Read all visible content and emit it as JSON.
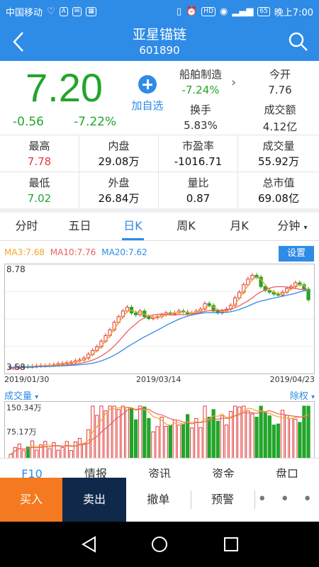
{
  "status_bar": {
    "carrier": "中国移动",
    "battery": "65",
    "time": "晚上7:00"
  },
  "header": {
    "title": "亚星锚链",
    "code": "601890"
  },
  "quote": {
    "price": "7.20",
    "change": "-0.56",
    "change_pct": "-7.22%",
    "add_watchlist": "加自选",
    "sector_name": "船舶制造",
    "sector_pct": "-7.24%",
    "open_label": "今开",
    "open_value": "7.76",
    "turnover_label": "换手",
    "turnover_value": "5.83%",
    "amount_label": "成交额",
    "amount_value": "4.12亿"
  },
  "grid": [
    {
      "label": "最高",
      "value": "7.78",
      "color": "#e03a3a"
    },
    {
      "label": "内盘",
      "value": "29.08万",
      "color": "#111111"
    },
    {
      "label": "市盈率",
      "value": "-1016.71",
      "color": "#111111"
    },
    {
      "label": "成交量",
      "value": "55.92万",
      "color": "#111111"
    },
    {
      "label": "最低",
      "value": "7.02",
      "color": "#22a52b"
    },
    {
      "label": "外盘",
      "value": "26.84万",
      "color": "#111111"
    },
    {
      "label": "量比",
      "value": "0.87",
      "color": "#111111"
    },
    {
      "label": "总市值",
      "value": "69.08亿",
      "color": "#111111"
    }
  ],
  "tabs": [
    "分时",
    "五日",
    "日K",
    "周K",
    "月K",
    "分钟"
  ],
  "active_tab": "日K",
  "chart": {
    "ma3": "MA3:7.68",
    "ma10": "MA10:7.76",
    "ma20": "MA20:7.62",
    "settings": "设置",
    "y_max": "8.78",
    "y_min": "3.58",
    "dates": [
      "2019/01/30",
      "2019/03/14",
      "2019/04/23"
    ],
    "volume_label": "成交量",
    "volume_max": "150.34万",
    "volume_mid": "75.17万",
    "adjust": "除权"
  },
  "chart_data": {
    "type": "candlestick",
    "ylim": [
      3.58,
      8.78
    ],
    "x_ticks": [
      "2019/01/30",
      "2019/03/14",
      "2019/04/23"
    ],
    "candles_approx_close": [
      3.6,
      3.62,
      3.62,
      3.65,
      3.64,
      3.66,
      3.68,
      3.7,
      3.7,
      3.72,
      3.75,
      3.8,
      3.82,
      3.85,
      3.88,
      3.95,
      4.0,
      4.1,
      4.3,
      4.5,
      4.7,
      5.0,
      5.3,
      5.6,
      6.0,
      6.3,
      6.6,
      6.8,
      6.5,
      6.4,
      6.6,
      6.3,
      6.2,
      6.25,
      6.3,
      6.4,
      6.5,
      6.45,
      6.5,
      6.6,
      6.55,
      6.45,
      6.5,
      6.6,
      6.7,
      7.0,
      6.9,
      6.6,
      6.5,
      6.6,
      6.7,
      6.9,
      7.3,
      7.6,
      8.0,
      8.3,
      8.5,
      8.4,
      7.9,
      7.7,
      7.6,
      7.5,
      7.45,
      7.6,
      7.8,
      7.9,
      8.1,
      8.0,
      7.76,
      7.2
    ],
    "volume_max": 150.34,
    "volume_unit": "万"
  },
  "subtabs": [
    "F10",
    "情报",
    "资讯",
    "资金",
    "盘口"
  ],
  "actions": {
    "buy": "买入",
    "sell": "卖出",
    "cancel": "撤单",
    "alert": "预警",
    "more": "• • •"
  },
  "colors": {
    "brand": "#2e8be6",
    "up": "#e03a3a",
    "down": "#22a52b",
    "buy_bg": "#f57920",
    "sell_bg": "#10294a",
    "ma3": "#f5a623",
    "ma10": "#e85f5f",
    "ma20": "#2e8be6"
  }
}
